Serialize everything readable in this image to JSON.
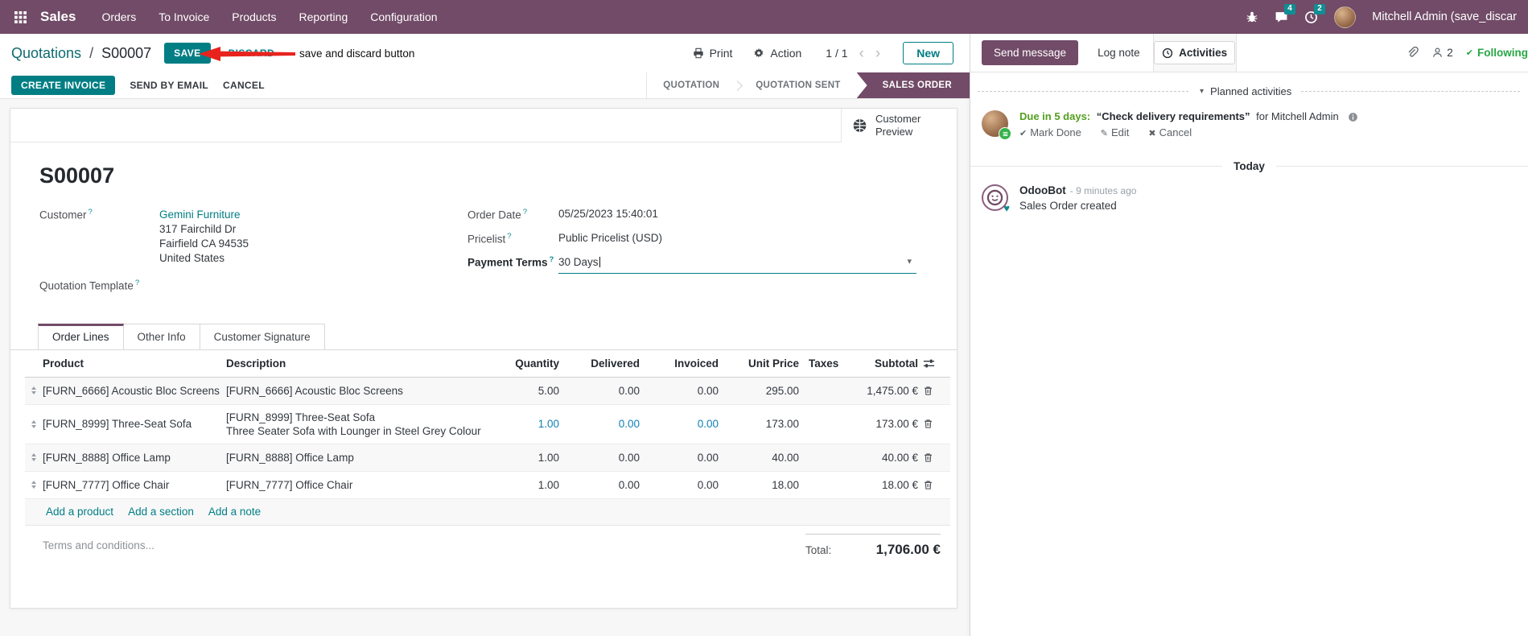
{
  "navbar": {
    "app_name": "Sales",
    "menus": [
      "Orders",
      "To Invoice",
      "Products",
      "Reporting",
      "Configuration"
    ],
    "messages_badge": "4",
    "activities_badge": "2",
    "user_name": "Mitchell Admin (save_discar"
  },
  "control_panel": {
    "breadcrumb_parent": "Quotations",
    "separator": "/",
    "record_name": "S00007",
    "save": "SAVE",
    "discard": "DISCARD",
    "annotation": "save and discard button",
    "print": "Print",
    "action": "Action",
    "pager": "1 / 1",
    "new": "New"
  },
  "statusbar": {
    "create_invoice": "CREATE INVOICE",
    "send_by_email": "SEND BY EMAIL",
    "cancel": "CANCEL",
    "stages": [
      {
        "label": "QUOTATION",
        "active": false
      },
      {
        "label": "QUOTATION SENT",
        "active": false
      },
      {
        "label": "SALES ORDER",
        "active": true
      }
    ]
  },
  "sheet": {
    "customer_preview": "Customer Preview",
    "title": "S00007",
    "help_marker": "?",
    "customer_label": "Customer",
    "customer_name": "Gemini Furniture",
    "address_line1": "317 Fairchild Dr",
    "address_line2": "Fairfield CA 94535",
    "address_line3": "United States",
    "quotation_template_label": "Quotation Template",
    "order_date_label": "Order Date",
    "order_date": "05/25/2023 15:40:01",
    "pricelist_label": "Pricelist",
    "pricelist": "Public Pricelist (USD)",
    "payment_terms_label": "Payment Terms",
    "payment_terms": "30 Days",
    "tabs": [
      {
        "label": "Order Lines"
      },
      {
        "label": "Other Info"
      },
      {
        "label": "Customer Signature"
      }
    ],
    "columns": {
      "product": "Product",
      "description": "Description",
      "quantity": "Quantity",
      "delivered": "Delivered",
      "invoiced": "Invoiced",
      "unit_price": "Unit Price",
      "taxes": "Taxes",
      "subtotal": "Subtotal"
    },
    "rows": [
      {
        "product": "[FURN_6666] Acoustic Bloc Screens",
        "desc1": "[FURN_6666] Acoustic Bloc Screens",
        "desc2": "",
        "quantity": "5.00",
        "delivered": "0.00",
        "invoiced": "0.00",
        "unit_price": "295.00",
        "taxes": "",
        "subtotal": "1,475.00 €"
      },
      {
        "product": "[FURN_8999] Three-Seat Sofa",
        "desc1": "[FURN_8999] Three-Seat Sofa",
        "desc2": "Three Seater Sofa with Lounger in Steel Grey Colour",
        "quantity": "1.00",
        "delivered": "0.00",
        "invoiced": "0.00",
        "unit_price": "173.00",
        "taxes": "",
        "subtotal": "173.00 €"
      },
      {
        "product": "[FURN_8888] Office Lamp",
        "desc1": "[FURN_8888] Office Lamp",
        "desc2": "",
        "quantity": "1.00",
        "delivered": "0.00",
        "invoiced": "0.00",
        "unit_price": "40.00",
        "taxes": "",
        "subtotal": "40.00 €"
      },
      {
        "product": "[FURN_7777] Office Chair",
        "desc1": "[FURN_7777] Office Chair",
        "desc2": "",
        "quantity": "1.00",
        "delivered": "0.00",
        "invoiced": "0.00",
        "unit_price": "18.00",
        "taxes": "",
        "subtotal": "18.00 €"
      }
    ],
    "add_product": "Add a product",
    "add_section": "Add a section",
    "add_note": "Add a note",
    "terms_placeholder": "Terms and conditions...",
    "total_label": "Total:",
    "total_value": "1,706.00 €"
  },
  "chatter": {
    "send_message": "Send message",
    "log_note": "Log note",
    "activities": "Activities",
    "followers_count": "2",
    "following": "Following",
    "planned_activities": "Planned activities",
    "activity_due": "Due in 5 days:",
    "activity_summary": "“Check delivery requirements”",
    "activity_for": "for Mitchell Admin",
    "mark_done": "Mark Done",
    "edit": "Edit",
    "cancel": "Cancel",
    "today": "Today",
    "author": "OdooBot",
    "message_time": "- 9 minutes ago",
    "message_body": "Sales Order created"
  },
  "icons": {
    "caret_down": "▾",
    "chevron_left": "‹",
    "chevron_right": "›",
    "check": "✔",
    "pencil": "✎",
    "x_mark": "✖",
    "heart": "♥"
  },
  "colors": {
    "brand_purple": "#714B67",
    "accent_teal": "#017E84",
    "badge_teal": "#0F8E93",
    "edited_value_blue": "#1081B4",
    "following_green": "#28A745",
    "due_green": "#53A01E",
    "annotation_red": "#E8231E"
  }
}
